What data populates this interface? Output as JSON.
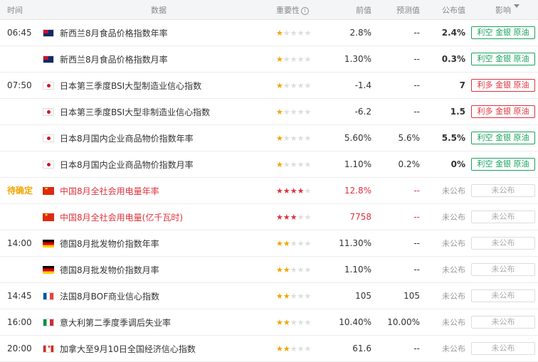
{
  "header": {
    "time": "时间",
    "data": "数据",
    "importance": "重要性",
    "prev": "前值",
    "forecast": "预测值",
    "actual": "公布值",
    "effect": "影响"
  },
  "rows": [
    {
      "time": "06:45",
      "flag": "nz",
      "name": "新西兰8月食品价格指数年率",
      "stars": 1,
      "prev": "2.8%",
      "forecast": "--",
      "actual": "2.4%",
      "effect": "利空 金银 原油",
      "effect_type": "green"
    },
    {
      "time": "",
      "flag": "nz",
      "name": "新西兰8月食品价格指数月率",
      "stars": 1,
      "prev": "1.30%",
      "forecast": "--",
      "actual": "0.3%",
      "effect": "利空 金银 原油",
      "effect_type": "green"
    },
    {
      "time": "07:50",
      "flag": "jp",
      "name": "日本第三季度BSI大型制造业信心指数",
      "stars": 1,
      "prev": "-1.4",
      "forecast": "--",
      "actual": "7",
      "effect": "利多 金银 原油",
      "effect_type": "red"
    },
    {
      "time": "",
      "flag": "jp",
      "name": "日本第三季度BSI大型非制造业信心指数",
      "stars": 1,
      "prev": "-6.2",
      "forecast": "--",
      "actual": "1.5",
      "effect": "利多 金银 原油",
      "effect_type": "red"
    },
    {
      "time": "",
      "flag": "jp",
      "name": "日本8月国内企业商品物价指数年率",
      "stars": 1,
      "prev": "5.60%",
      "forecast": "5.6%",
      "actual": "5.5%",
      "effect": "利空 金银 原油",
      "effect_type": "green"
    },
    {
      "time": "",
      "flag": "jp",
      "name": "日本8月国内企业商品物价指数月率",
      "stars": 1,
      "prev": "1.10%",
      "forecast": "0.2%",
      "actual": "0%",
      "effect": "利空 金银 原油",
      "effect_type": "green"
    },
    {
      "time": "待确定",
      "flag": "cn",
      "name": "中国8月全社会用电量年率",
      "stars": 4,
      "prev": "12.8%",
      "forecast": "--",
      "actual": "未公布",
      "effect": "未公布",
      "effect_type": "gray",
      "highlight": true
    },
    {
      "time": "",
      "flag": "cn",
      "name": "中国8月全社会用电量(亿千瓦时)",
      "stars": 3,
      "prev": "7758",
      "forecast": "--",
      "actual": "未公布",
      "effect": "未公布",
      "effect_type": "gray",
      "highlight": true
    },
    {
      "time": "14:00",
      "flag": "de",
      "name": "德国8月批发物价指数年率",
      "stars": 2,
      "prev": "11.30%",
      "forecast": "--",
      "actual": "未公布",
      "effect": "未公布",
      "effect_type": "gray"
    },
    {
      "time": "",
      "flag": "de",
      "name": "德国8月批发物价指数月率",
      "stars": 2,
      "prev": "1.10%",
      "forecast": "--",
      "actual": "未公布",
      "effect": "未公布",
      "effect_type": "gray"
    },
    {
      "time": "14:45",
      "flag": "fr",
      "name": "法国8月BOF商业信心指数",
      "stars": 2,
      "prev": "105",
      "forecast": "105",
      "actual": "未公布",
      "effect": "未公布",
      "effect_type": "gray"
    },
    {
      "time": "16:00",
      "flag": "it",
      "name": "意大利第二季度季调后失业率",
      "stars": 2,
      "prev": "10.40%",
      "forecast": "10.00%",
      "actual": "未公布",
      "effect": "未公布",
      "effect_type": "gray"
    },
    {
      "time": "20:00",
      "flag": "ca",
      "name": "加拿大至9月10日全国经济信心指数",
      "stars": 2,
      "prev": "61.6",
      "forecast": "--",
      "actual": "未公布",
      "effect": "未公布",
      "effect_type": "gray"
    }
  ]
}
